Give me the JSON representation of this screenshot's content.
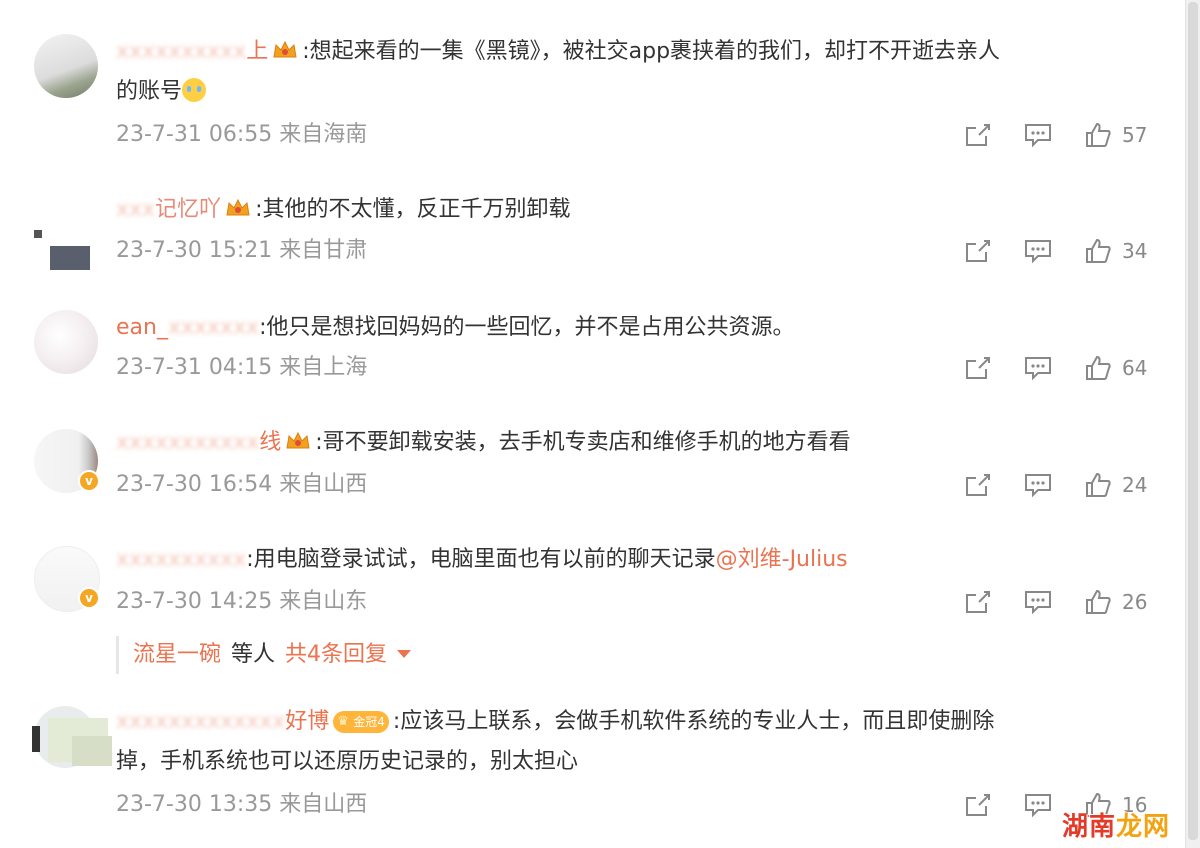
{
  "comments": [
    {
      "user": "上",
      "text": ":想起来看的一集《黑镜》，被社交app裹挟着的我们，却打不开逝去亲人",
      "text_cont": "的账号",
      "has_emoji": true,
      "time": "23-7-31 06:55 来自海南",
      "likes": "57"
    },
    {
      "user": "记忆吖",
      "text": ":其他的不太懂，反正千万别卸载",
      "time": "23-7-30 15:21 来自甘肃",
      "likes": "34"
    },
    {
      "user": "ean_",
      "text": ":他只是想找回妈妈的一些回忆，并不是占用公共资源。",
      "time": "23-7-31 04:15 来自上海",
      "likes": "64"
    },
    {
      "user": "线",
      "text": ":哥不要卸载安装，去手机专卖店和维修手机的地方看看",
      "time": "23-7-30 16:54 来自山西",
      "likes": "24"
    },
    {
      "user": "",
      "text": ":用电脑登录试试，电脑里面也有以前的聊天记录",
      "mention": "@刘维-Julius",
      "time": "23-7-30 14:25 来自山东",
      "likes": "26"
    },
    {
      "user": "好博",
      "badge": "金冠4",
      "text": ":应该马上联系，会做手机软件系统的专业人士，而且即使删除",
      "text_cont": "掉，手机系统也可以还原历史记录的，别太担心",
      "time": "23-7-30 13:35 来自山西",
      "likes": "16"
    }
  ],
  "reply_bar": {
    "user": "流星一碗",
    "middle": "等人",
    "total": "共4条回复"
  },
  "watermark": {
    "part1": "湖南",
    "part2": "龙网"
  },
  "colors": {
    "username": "#eb7350",
    "meta": "#999999",
    "text": "#333333"
  }
}
